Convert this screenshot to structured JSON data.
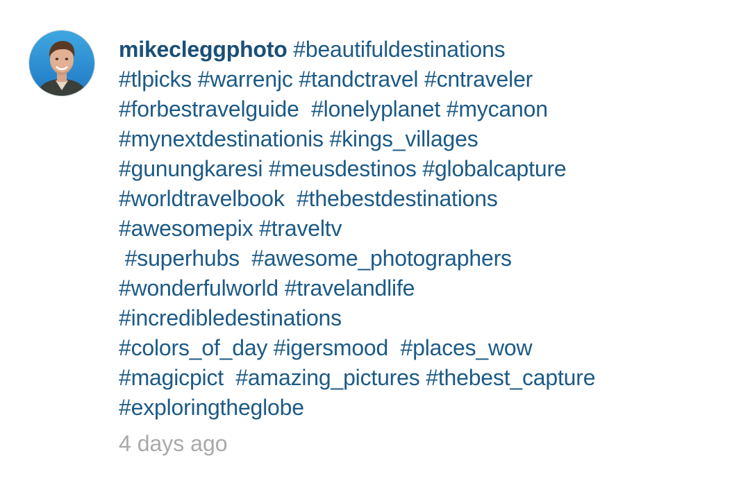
{
  "post_comment": {
    "username": "mikecleggphoto",
    "lines": [
      " #beautifuldestinations",
      "#tlpicks #warrenjc #tandctravel #cntraveler",
      "#forbestravelguide  #lonelyplanet #mycanon",
      "#mynextdestinationis #kings_villages",
      "#gunungkaresi #meusdestinos #globalcapture",
      "#worldtravelbook  #thebestdestinations",
      "#awesomepix #traveltv",
      " #superhubs  #awesome_photographers",
      "#wonderfulworld #travelandlife",
      "#incredibledestinations",
      "#colors_of_day #igersmood  #places_wow",
      "#magicpict  #amazing_pictures #thebest_capture",
      "#exploringtheglobe"
    ],
    "timestamp": "4 days ago"
  },
  "colors": {
    "link": "#1c5a86",
    "username": "#1a4f78",
    "timestamp": "#a9a9a9",
    "background": "#ffffff"
  },
  "icons": {
    "avatar": "profile-photo"
  }
}
